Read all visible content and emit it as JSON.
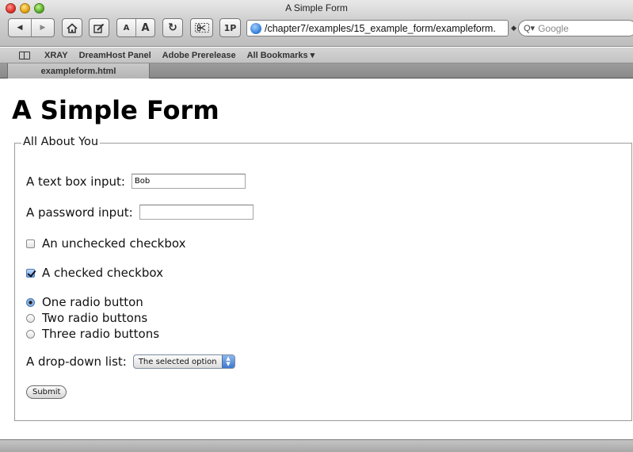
{
  "window": {
    "title": "A Simple Form"
  },
  "toolbar": {
    "back_label": "◀",
    "forward_label": "▶",
    "text_smaller": "A",
    "text_bigger": "A",
    "reload_label": "↻",
    "onepassword_label": "1P",
    "address": "/chapter7/examples/15_example_form/exampleform.",
    "search_placeholder": "Google"
  },
  "bookmarks": {
    "items": [
      "XRAY",
      "DreamHost Panel",
      "Adobe Prerelease",
      "All Bookmarks ▾"
    ]
  },
  "tabs": [
    {
      "label": "exampleform.html"
    }
  ],
  "page": {
    "heading": "A Simple Form",
    "fieldset_legend": "All About You",
    "text_box_label": "A text box input:",
    "text_box_value": "Bob",
    "password_label": "A password input:",
    "password_value": "",
    "unchecked_label": "An unchecked checkbox",
    "checked_label": "A checked checkbox",
    "radios": [
      "One radio button",
      "Two radio buttons",
      "Three radio buttons"
    ],
    "dropdown_label": "A drop-down list:",
    "dropdown_selected": "The selected option",
    "submit_label": "Submit"
  },
  "colors": {
    "accent": "#3d78cf",
    "chrome": "#c3c3c3"
  }
}
